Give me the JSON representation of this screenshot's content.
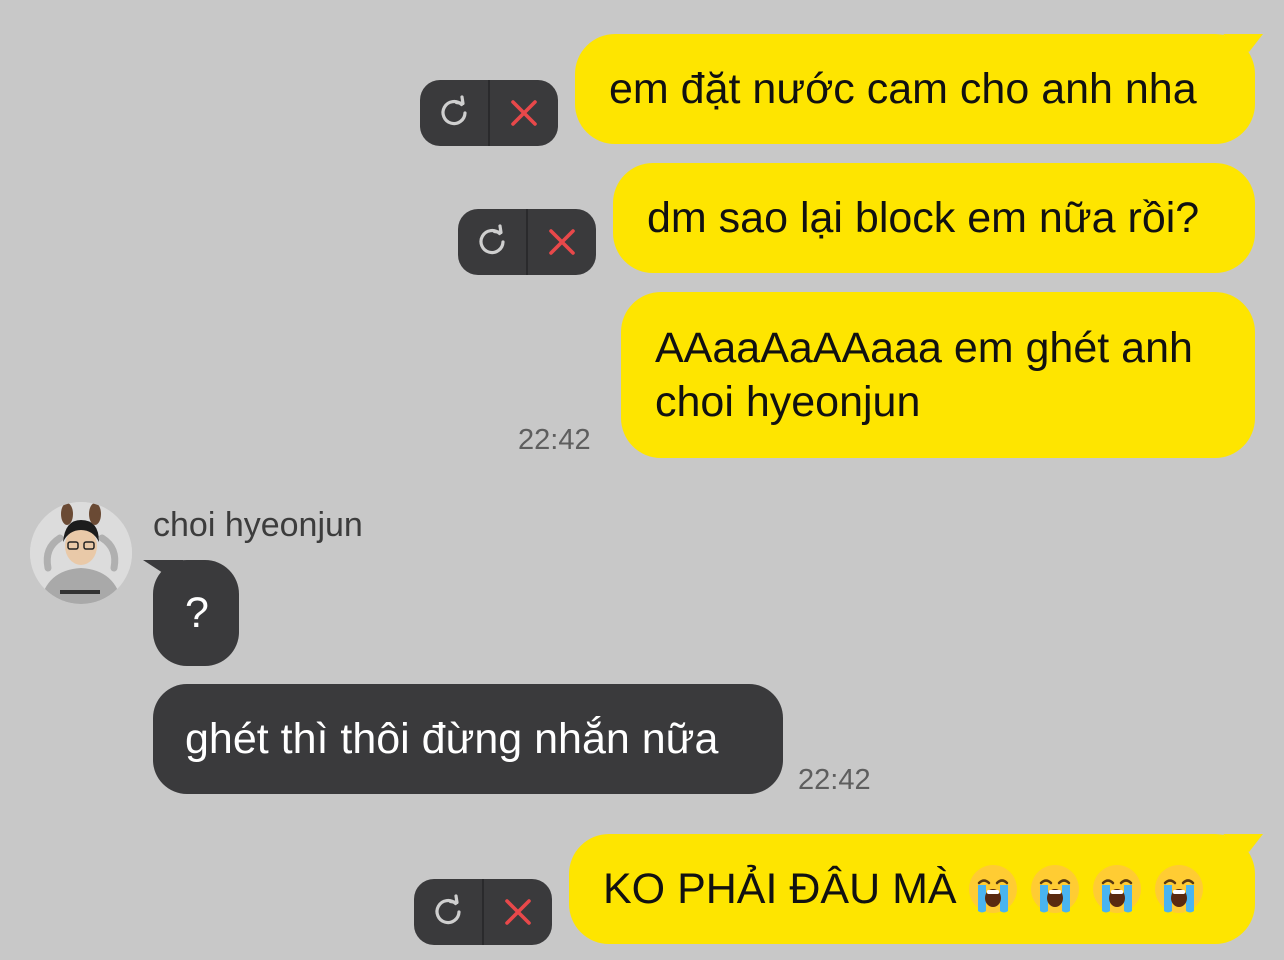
{
  "messages": {
    "m1": "em đặt nước cam cho anh nha",
    "m2": "dm sao lại block em nữa rồi?",
    "m3_line1": "AAaaAaAAaaa em ghét anh",
    "m3_line2": "choi hyeonjun",
    "m3_time": "22:42",
    "sender_name": "choi hyeonjun",
    "r1": "?",
    "r2": "ghét thì thôi đừng nhắn nữa",
    "r_time": "22:42",
    "m4": "KO PHẢI ĐÂU MÀ"
  },
  "icons": {
    "retry": "retry-icon",
    "delete": "close-icon",
    "emoji": "loudly-crying-face-emoji"
  },
  "colors": {
    "background": "#c8c8c8",
    "outgoing_bubble": "#fee500",
    "incoming_bubble": "#3a3a3c",
    "delete_accent": "#e8484a"
  }
}
